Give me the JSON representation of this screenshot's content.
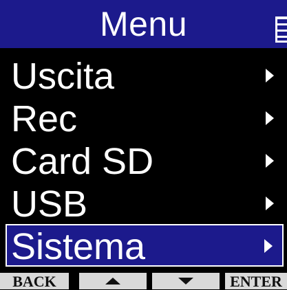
{
  "header": {
    "title": "Menu"
  },
  "menu": {
    "items": [
      {
        "label": "Uscita",
        "icon": "chevron-right-icon",
        "selected": false
      },
      {
        "label": "Rec",
        "icon": "chevron-right-icon",
        "selected": false
      },
      {
        "label": "Card SD",
        "icon": "chevron-right-icon",
        "selected": false
      },
      {
        "label": "USB",
        "icon": "chevron-right-icon",
        "selected": false
      },
      {
        "label": "Sistema",
        "icon": "chevron-right-icon",
        "selected": true
      }
    ]
  },
  "softkeys": {
    "back_label": "BACK",
    "up_icon": "triangle-up-icon",
    "down_icon": "triangle-down-icon",
    "enter_label": "ENTER"
  },
  "colors": {
    "background": "#000000",
    "accent": "#1c1a8c",
    "text": "#ffffff",
    "softkey_bg": "#d9d9d9",
    "softkey_text": "#111111"
  }
}
